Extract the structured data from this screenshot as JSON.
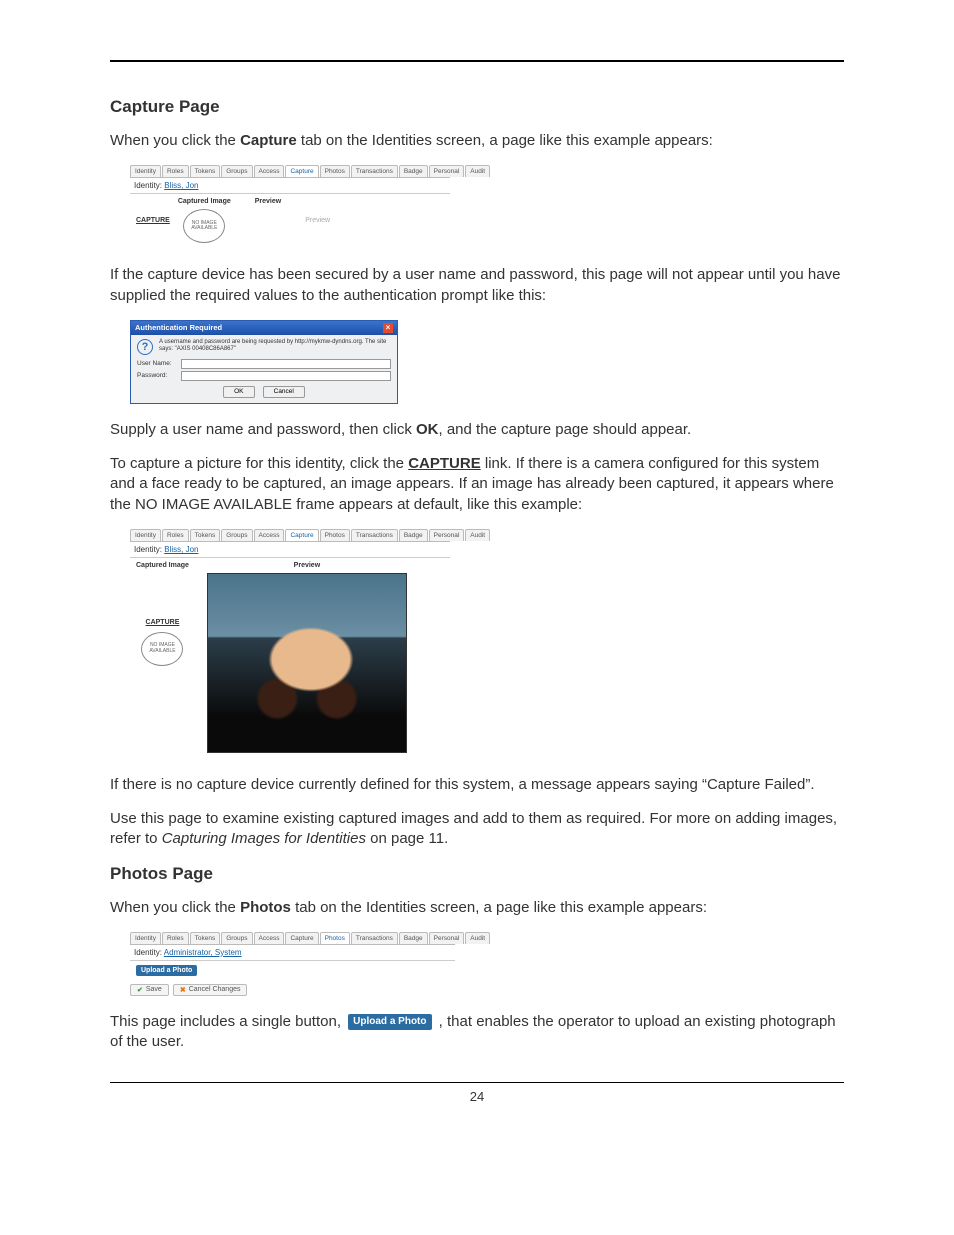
{
  "page_number": "24",
  "section1": {
    "heading": "Capture Page",
    "p1_a": "When you click the ",
    "p1_bold": "Capture",
    "p1_b": " tab on the Identities screen, a page like this example appears:"
  },
  "fig_tabs": [
    "Identity",
    "Roles",
    "Tokens",
    "Groups",
    "Access",
    "Capture",
    "Photos",
    "Transactions",
    "Badge",
    "Personal",
    "Audit"
  ],
  "fig1": {
    "identity_label": "Identity: ",
    "identity_name": "Bliss, Jon",
    "col1": "Captured Image",
    "col2": "Preview",
    "capture_link": "CAPTURE",
    "no_image": "NO IMAGE AVAILABLE",
    "preview_disabled": "Preview"
  },
  "p2": "If the capture device has been secured by a user name and password, this page will not appear until you have supplied the required values to the authentication prompt like this:",
  "auth": {
    "title": "Authentication Required",
    "msg": "A username and password are being requested by http://mykmw-dyndns.org. The site says: \"AXIS 00408C86A867\"",
    "user_label": "User Name:",
    "pass_label": "Password:",
    "ok": "OK",
    "cancel": "Cancel"
  },
  "p3_a": "Supply a user name and password, then click ",
  "p3_bold": "OK",
  "p3_b": ", and the capture page should appear.",
  "p4_a": "To capture a picture for this identity, click the ",
  "p4_bold": "CAPTURE",
  "p4_b": " link. If there is a camera configured for this system and a face ready to be captured, an image appears. If an image has already been captured, it appears where the NO IMAGE AVAILABLE frame appears at default, like this example:",
  "fig3": {
    "identity_name": "Bliss, Jon",
    "col1": "Captured Image",
    "col2": "Preview"
  },
  "p5": "If there is no capture device currently defined for this system, a message appears saying “Capture Failed”.",
  "p6_a": "Use this page to examine existing captured images and add to them as required. For more on adding images, refer to ",
  "p6_italic": "Capturing Images for Identities",
  "p6_b": " on page 11.",
  "section2": {
    "heading": "Photos Page",
    "p1_a": "When you click the ",
    "p1_bold": "Photos",
    "p1_b": " tab on the Identities screen, a page like this example appears:"
  },
  "fig4": {
    "identity_label": "Identity: ",
    "identity_name": "Administrator, System",
    "upload_btn": "Upload a Photo",
    "save_btn": "Save",
    "cancel_btn": "Cancel Changes"
  },
  "p7_a": "This page includes a single button, ",
  "p7_btn": "Upload a Photo",
  "p7_b": " , that enables the operator to upload an existing photograph of the user."
}
